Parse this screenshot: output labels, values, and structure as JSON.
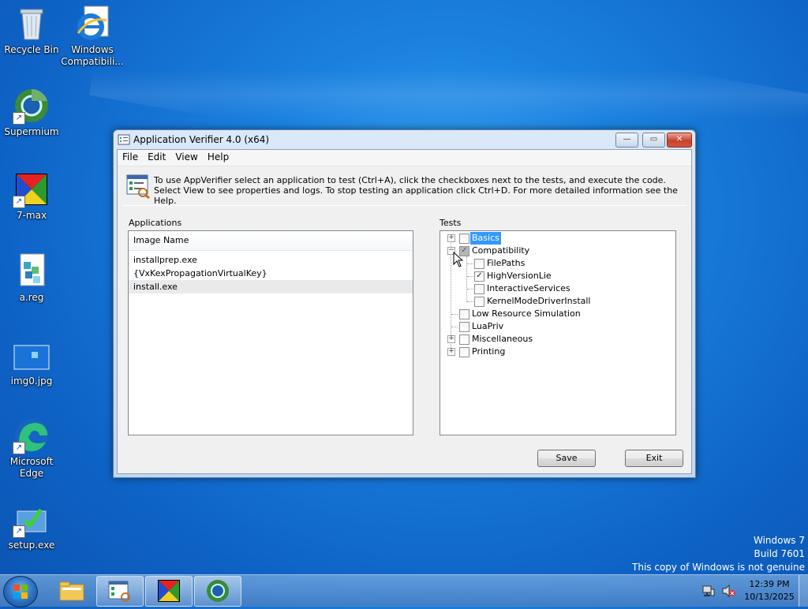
{
  "desktop": {
    "icons": [
      {
        "label": "Recycle Bin",
        "icon": "recycle-bin-icon"
      },
      {
        "label": "Windows Compatibili...",
        "icon": "internet-explorer-icon"
      },
      {
        "label": "Supermium",
        "icon": "supermium-icon"
      },
      {
        "label": "7-max",
        "icon": "7-max-icon"
      },
      {
        "label": "a.reg",
        "icon": "registry-file-icon"
      },
      {
        "label": "img0.jpg",
        "icon": "image-file-icon"
      },
      {
        "label": "Microsoft Edge",
        "icon": "edge-icon"
      },
      {
        "label": "setup.exe",
        "icon": "setup-icon"
      }
    ],
    "watermark": [
      "Windows 7",
      "Build 7601",
      "This copy of Windows is not genuine"
    ]
  },
  "window": {
    "title": "Application Verifier 4.0 (x64)",
    "controls": {
      "minimize": "—",
      "maximize": "▭",
      "close": "✕"
    },
    "menu": [
      "File",
      "Edit",
      "View",
      "Help"
    ],
    "info_text": "To use AppVerifier select an application to test (Ctrl+A), click the checkboxes next to the tests, and execute the code. Select View to see properties and logs. To stop testing an application click Ctrl+D. For more detailed information see the Help.",
    "applications": {
      "label": "Applications",
      "column": "Image Name",
      "rows": [
        "installprep.exe",
        "{VxKexPropagationVirtualKey}",
        "install.exe"
      ],
      "selected_index": 2
    },
    "tests": {
      "label": "Tests",
      "nodes": [
        {
          "label": "Basics",
          "expander": "+",
          "checked": false,
          "highlighted": true
        },
        {
          "label": "Compatibility",
          "expander": "−",
          "checked": true,
          "indeterminate": true
        },
        {
          "label": "FilePaths",
          "checked": false
        },
        {
          "label": "HighVersionLie",
          "checked": true
        },
        {
          "label": "InteractiveServices",
          "checked": false
        },
        {
          "label": "KernelModeDriverInstall",
          "checked": false
        },
        {
          "label": "Low Resource Simulation",
          "checked": false
        },
        {
          "label": "LuaPriv",
          "checked": false
        },
        {
          "label": "Miscellaneous",
          "expander": "+",
          "checked": false
        },
        {
          "label": "Printing",
          "expander": "+",
          "checked": false
        }
      ]
    },
    "buttons": {
      "save": "Save",
      "exit": "Exit"
    }
  },
  "taskbar": {
    "items": [
      "windows-explorer-icon",
      "app-verifier-icon",
      "7-max-icon",
      "supermium-icon"
    ],
    "clock": {
      "time": "12:39 PM",
      "date": "10/13/2025"
    }
  },
  "colors": {
    "selection": "#3399ff",
    "desktop": "#1b82e0"
  }
}
